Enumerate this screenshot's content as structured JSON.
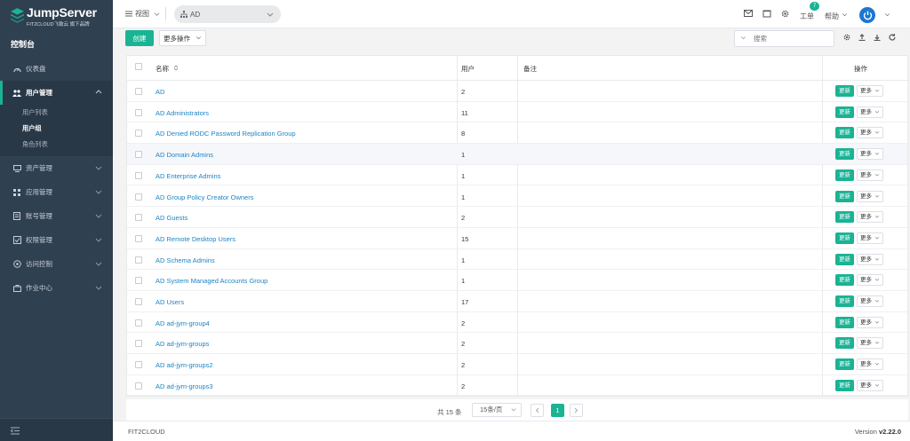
{
  "brand": {
    "name": "JumpServer",
    "tagline": "FIT2CLOUD飞致云 旗下品牌",
    "accent": "#1ab394",
    "sidebar_bg": "#2f4050"
  },
  "sidebar": {
    "console_label": "控制台",
    "items": [
      {
        "label": "仪表盘",
        "icon": "dashboard-icon"
      },
      {
        "label": "用户管理",
        "icon": "users-icon",
        "expanded": true
      },
      {
        "label": "资产管理",
        "icon": "assets-icon"
      },
      {
        "label": "应用管理",
        "icon": "apps-icon"
      },
      {
        "label": "账号管理",
        "icon": "accounts-icon"
      },
      {
        "label": "权限管理",
        "icon": "perms-icon"
      },
      {
        "label": "访问控制",
        "icon": "acl-icon"
      },
      {
        "label": "作业中心",
        "icon": "ops-icon"
      }
    ],
    "sub_items": [
      {
        "label": "用户列表"
      },
      {
        "label": "用户组",
        "current": true
      },
      {
        "label": "角色列表"
      }
    ]
  },
  "topbar": {
    "view_label": "视图",
    "org_label": "AD",
    "tickets_label": "工单",
    "tickets_badge": "7",
    "help_label": "帮助"
  },
  "toolbar": {
    "create_label": "创建",
    "more_actions_label": "更多操作",
    "search_placeholder": "搜索"
  },
  "table": {
    "headers": {
      "name": "名称",
      "users": "用户",
      "comment": "备注",
      "actions": "操作"
    },
    "action_update": "更新",
    "action_more": "更多",
    "rows": [
      {
        "name": "AD",
        "users": "2"
      },
      {
        "name": "AD Administrators",
        "users": "11"
      },
      {
        "name": "AD Denied RODC Password Replication Group",
        "users": "8"
      },
      {
        "name": "AD Domain Admins",
        "users": "1"
      },
      {
        "name": "AD Enterprise Admins",
        "users": "1"
      },
      {
        "name": "AD Group Policy Creator Owners",
        "users": "1"
      },
      {
        "name": "AD Guests",
        "users": "2"
      },
      {
        "name": "AD Remote Desktop Users",
        "users": "15"
      },
      {
        "name": "AD Schema Admins",
        "users": "1"
      },
      {
        "name": "AD System Managed Accounts Group",
        "users": "1"
      },
      {
        "name": "AD Users",
        "users": "17"
      },
      {
        "name": "AD ad-jym-group4",
        "users": "2"
      },
      {
        "name": "AD ad-jym-groups",
        "users": "2"
      },
      {
        "name": "AD ad-jym-groups2",
        "users": "2"
      },
      {
        "name": "AD ad-jym-groups3",
        "users": "2"
      }
    ]
  },
  "pagination": {
    "total_label": "共 15 条",
    "page_size": "15条/页",
    "current_page": "1"
  },
  "footer": {
    "company": "FIT2CLOUD",
    "version_prefix": "Version",
    "version": "v2.22.0"
  }
}
